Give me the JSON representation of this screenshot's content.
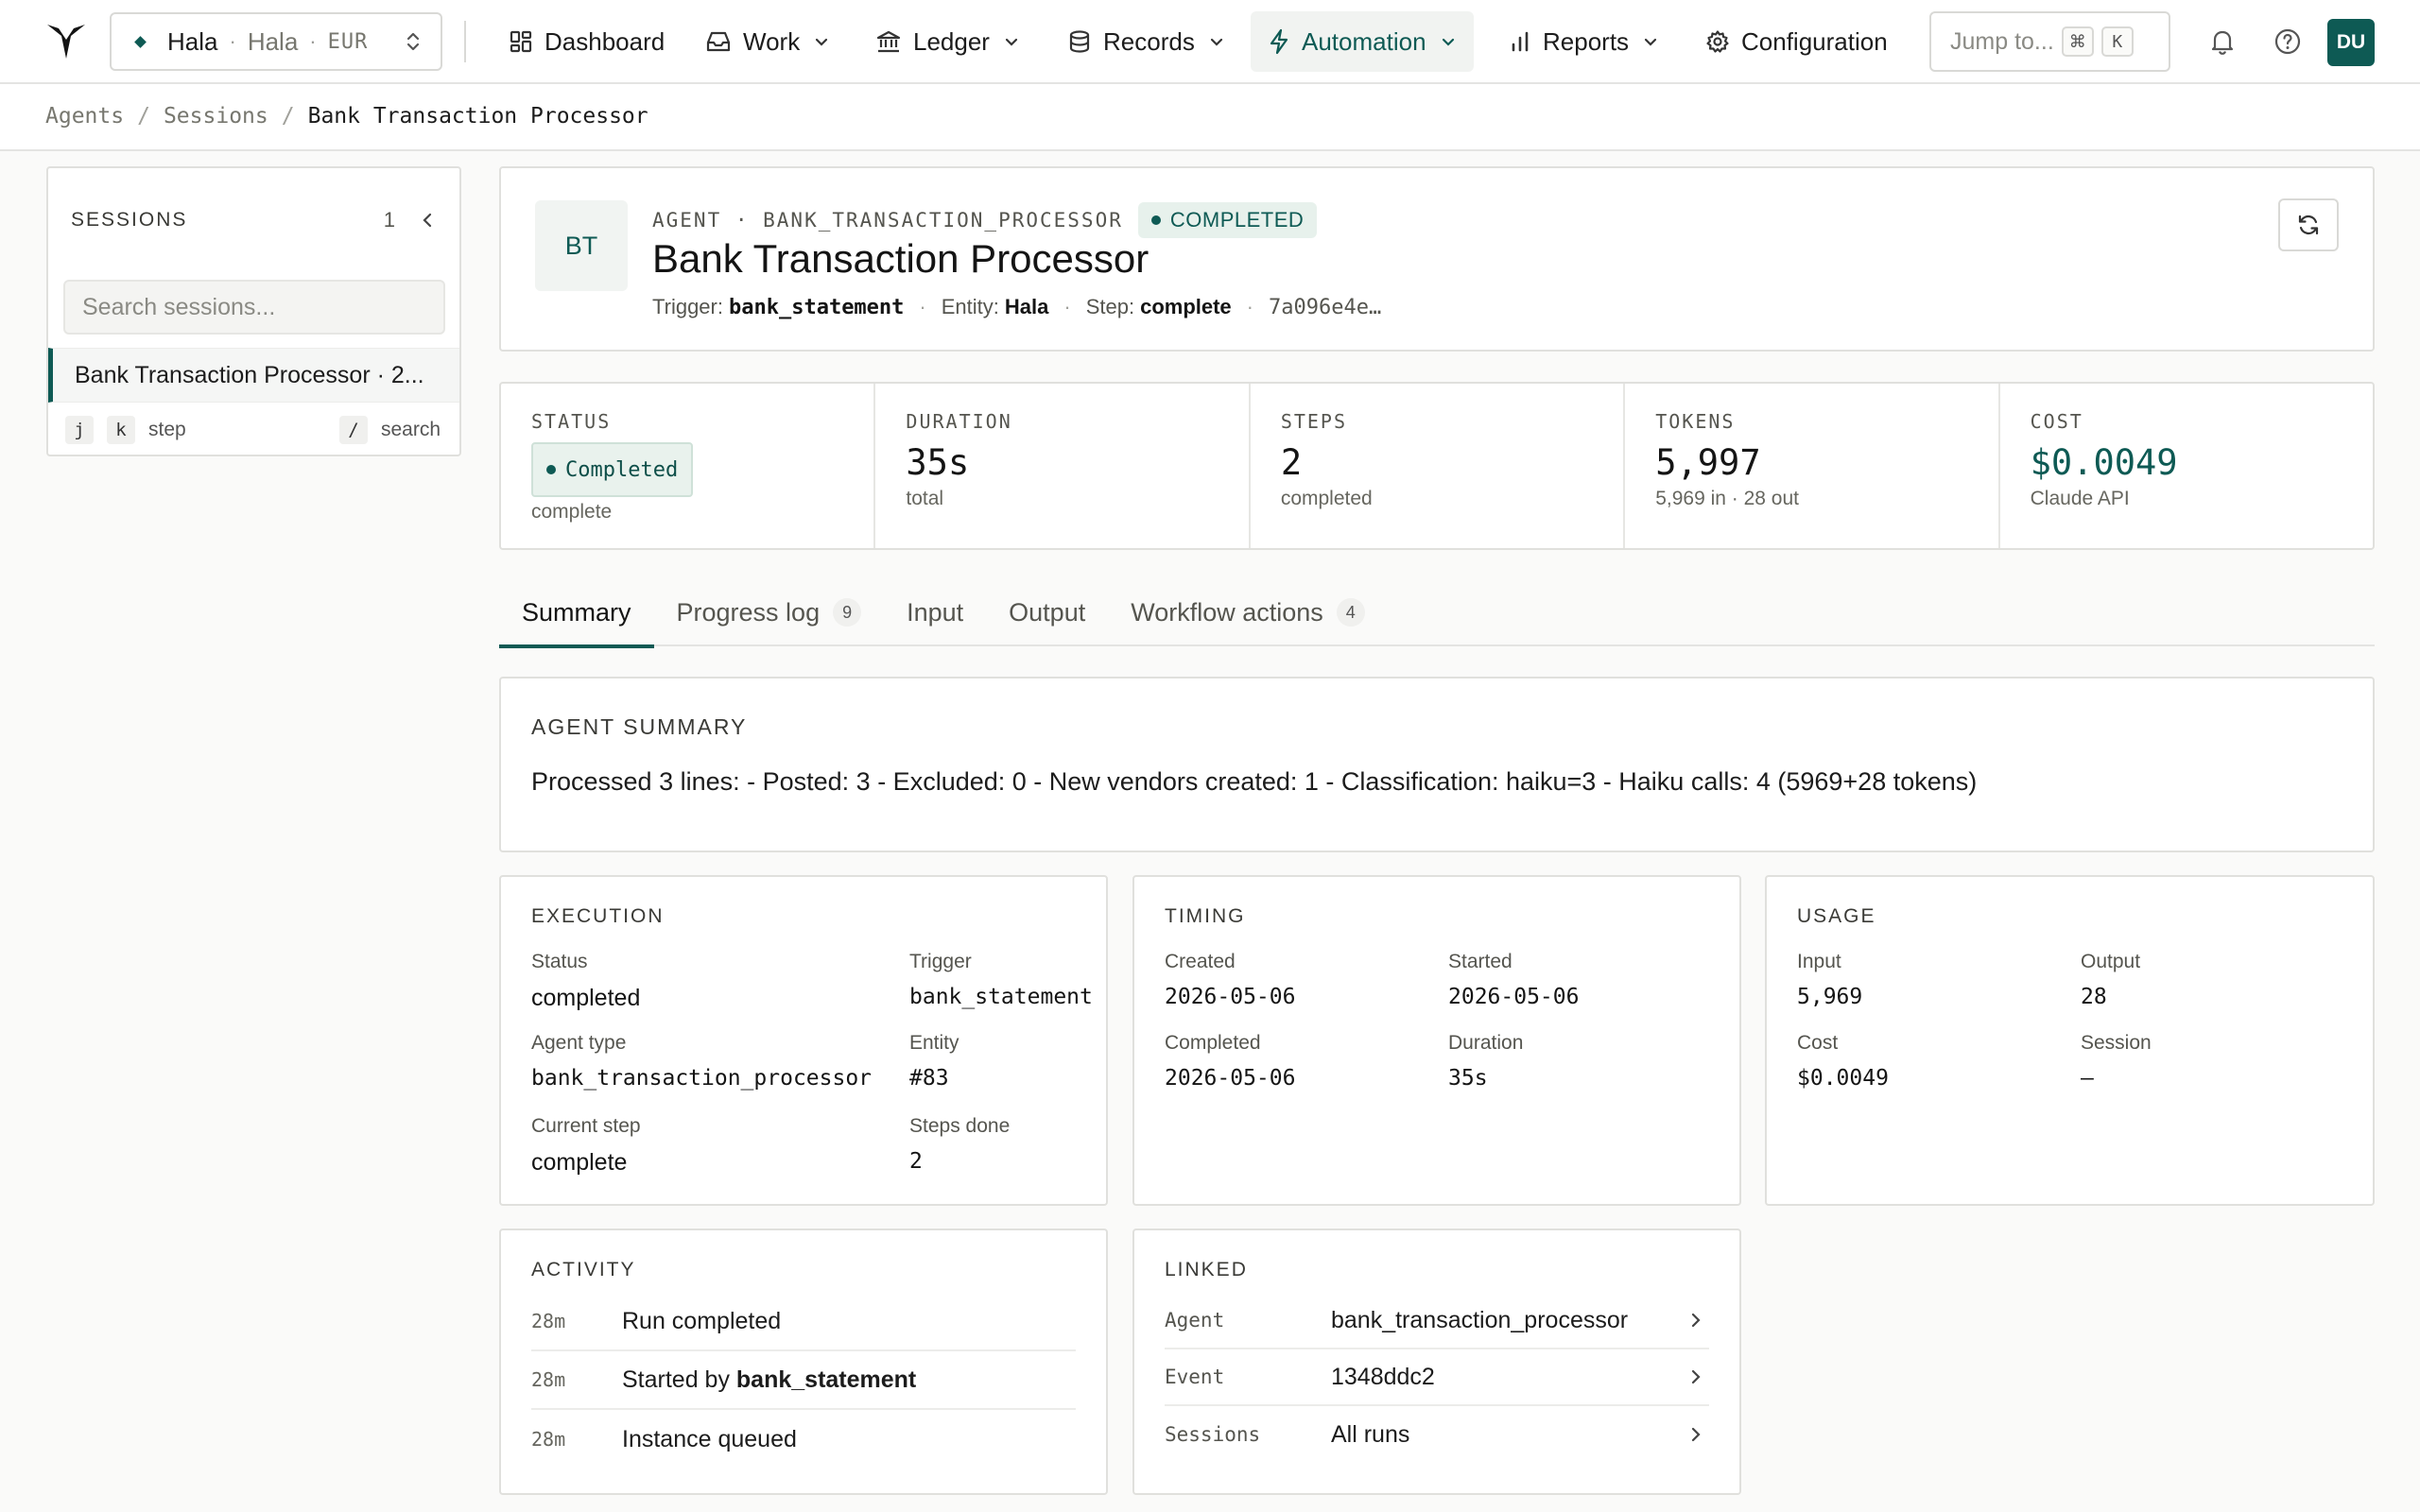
{
  "nav": {
    "entity": {
      "name": "Hala",
      "sub": "Hala",
      "currency": "EUR"
    },
    "items": [
      {
        "label": "Dashboard"
      },
      {
        "label": "Work"
      },
      {
        "label": "Ledger"
      },
      {
        "label": "Records"
      },
      {
        "label": "Automation"
      },
      {
        "label": "Reports"
      },
      {
        "label": "Configuration"
      }
    ],
    "jump": {
      "label": "Jump to...",
      "key1": "⌘",
      "key2": "K"
    },
    "avatar": "DU"
  },
  "breadcrumb": [
    "Agents",
    "Sessions",
    "Bank Transaction Processor"
  ],
  "sessions": {
    "title": "SESSIONS",
    "count": "1",
    "search_placeholder": "Search sessions...",
    "items": [
      {
        "label": "Bank Transaction Processor · 2..."
      }
    ],
    "keys": {
      "k1": "j",
      "k2": "k",
      "step": "step",
      "k3": "/",
      "search": "search"
    }
  },
  "agent": {
    "badge": "BT",
    "meta": "AGENT · BANK_TRANSACTION_PROCESSOR",
    "status_pill": "COMPLETED",
    "title": "Bank Transaction Processor",
    "trigger_label": "Trigger:",
    "trigger": "bank_statement",
    "entity_label": "Entity:",
    "entity": "Hala",
    "step_label": "Step:",
    "step": "complete",
    "hash": "7a096e4e…"
  },
  "stats": {
    "status": {
      "label": "STATUS",
      "value": "Completed",
      "sub": "complete"
    },
    "duration": {
      "label": "DURATION",
      "value": "35s",
      "sub": "total"
    },
    "steps": {
      "label": "STEPS",
      "value": "2",
      "sub": "completed"
    },
    "tokens": {
      "label": "TOKENS",
      "value": "5,997",
      "sub": "5,969 in · 28 out"
    },
    "cost": {
      "label": "COST",
      "value": "$0.0049",
      "sub": "Claude API"
    }
  },
  "tabs": [
    {
      "label": "Summary"
    },
    {
      "label": "Progress log",
      "badge": "9"
    },
    {
      "label": "Input"
    },
    {
      "label": "Output"
    },
    {
      "label": "Workflow actions",
      "badge": "4"
    }
  ],
  "summary": {
    "title": "AGENT SUMMARY",
    "text": "Processed 3 lines: - Posted: 3 - Excluded: 0 - New vendors created: 1 - Classification: haiku=3 - Haiku calls: 4 (5969+28 tokens)"
  },
  "execution": {
    "title": "EXECUTION",
    "status_k": "Status",
    "status_v": "completed",
    "trigger_k": "Trigger",
    "trigger_v": "bank_statement",
    "agent_type_k": "Agent type",
    "agent_type_v": "bank_transaction_processor",
    "entity_k": "Entity",
    "entity_v": "#83",
    "current_step_k": "Current step",
    "current_step_v": "complete",
    "steps_done_k": "Steps done",
    "steps_done_v": "2"
  },
  "timing": {
    "title": "TIMING",
    "created_k": "Created",
    "created_v": "2026-05-06",
    "started_k": "Started",
    "started_v": "2026-05-06",
    "completed_k": "Completed",
    "completed_v": "2026-05-06",
    "duration_k": "Duration",
    "duration_v": "35s"
  },
  "usage": {
    "title": "USAGE",
    "input_k": "Input",
    "input_v": "5,969",
    "output_k": "Output",
    "output_v": "28",
    "cost_k": "Cost",
    "cost_v": "$0.0049",
    "session_k": "Session",
    "session_v": "—"
  },
  "activity": {
    "title": "ACTIVITY",
    "rows": [
      {
        "time": "28m",
        "text": "Run completed"
      },
      {
        "time": "28m",
        "text": "Started by ",
        "bold": "bank_statement"
      },
      {
        "time": "28m",
        "text": "Instance queued"
      }
    ]
  },
  "linked": {
    "title": "LINKED",
    "rows": [
      {
        "k": "Agent",
        "v": "bank_transaction_processor"
      },
      {
        "k": "Event",
        "v": "1348ddc2"
      },
      {
        "k": "Sessions",
        "v": "All runs"
      }
    ]
  },
  "colors": {
    "accent": "#0e5a54",
    "accent_bg": "#e7f1ec",
    "border": "#e0e0dd"
  }
}
